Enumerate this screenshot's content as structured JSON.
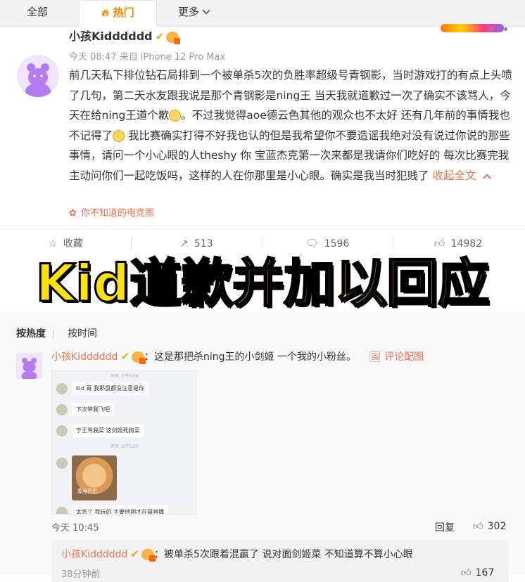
{
  "tabs": {
    "all": "全部",
    "hot": "热门",
    "more": "更多"
  },
  "post": {
    "username": "小孩Kidddddd",
    "meta": "今天 08:47 来自 iPhone 12 Pro Max",
    "content_1": "前几天私下排位钻石局排到一个被单杀5次的负胜率超级号青钢影，当时游戏打的有点上头喷了几句，第二天水友跟我说是那个青钢影是ning王 当天我就道歉过一次了确实不该骂人，今天在给ning王道个歉",
    "content_2": "。不过我觉得aoe德云色其他的观众也不太好 还有几年前的事情我也不记得了",
    "content_3": " 我比赛确实打得不好我也认的但是我希望你不要造谣我绝对没有说过你说的那些事情，请问一个小心眼的人theshy 你 宝蓝杰克第一次来都是我请你们吃好的 每次比赛完我主动问你们一起吃饭吗，这样的人在你那里是小心眼。确实是我当时犯贱了",
    "collapse": "收起全文",
    "topic": "你不知道的电竞圈"
  },
  "actions": {
    "favorite": "收藏",
    "repost": "513",
    "comment": "1596",
    "like": "14982"
  },
  "overlay_title": "Kid道歉并加以回应",
  "sort": {
    "by_heat": "按热度",
    "by_time": "按时间"
  },
  "comment": {
    "username": "小孩Kidddddd",
    "text": "：这是那把杀ning王的小剑姬 一个我的小粉丝。",
    "image_link": "评论配图",
    "time": "今天 10:45",
    "reply": "回复",
    "likes": "302",
    "chat": {
      "ts1": "昨天 上午3:08",
      "msg1": "kid 哥 我那盘都没注意是你",
      "msg2": "下次带我飞吧",
      "msg3": "宁王骂我菜 这剑姬死狗菜",
      "ts2": "昨天 上午3:06",
      "cat_caption": "委屈巴巴",
      "msg4": "太急了 我玩的 主要他刚才在哥直播"
    }
  },
  "sub_comment": {
    "username": "小孩Kidddddd",
    "text": "：被单杀5次跟着混赢了 说对面剑姬菜 不知道算不算小心眼",
    "time": "38分钟前",
    "likes": "167"
  }
}
